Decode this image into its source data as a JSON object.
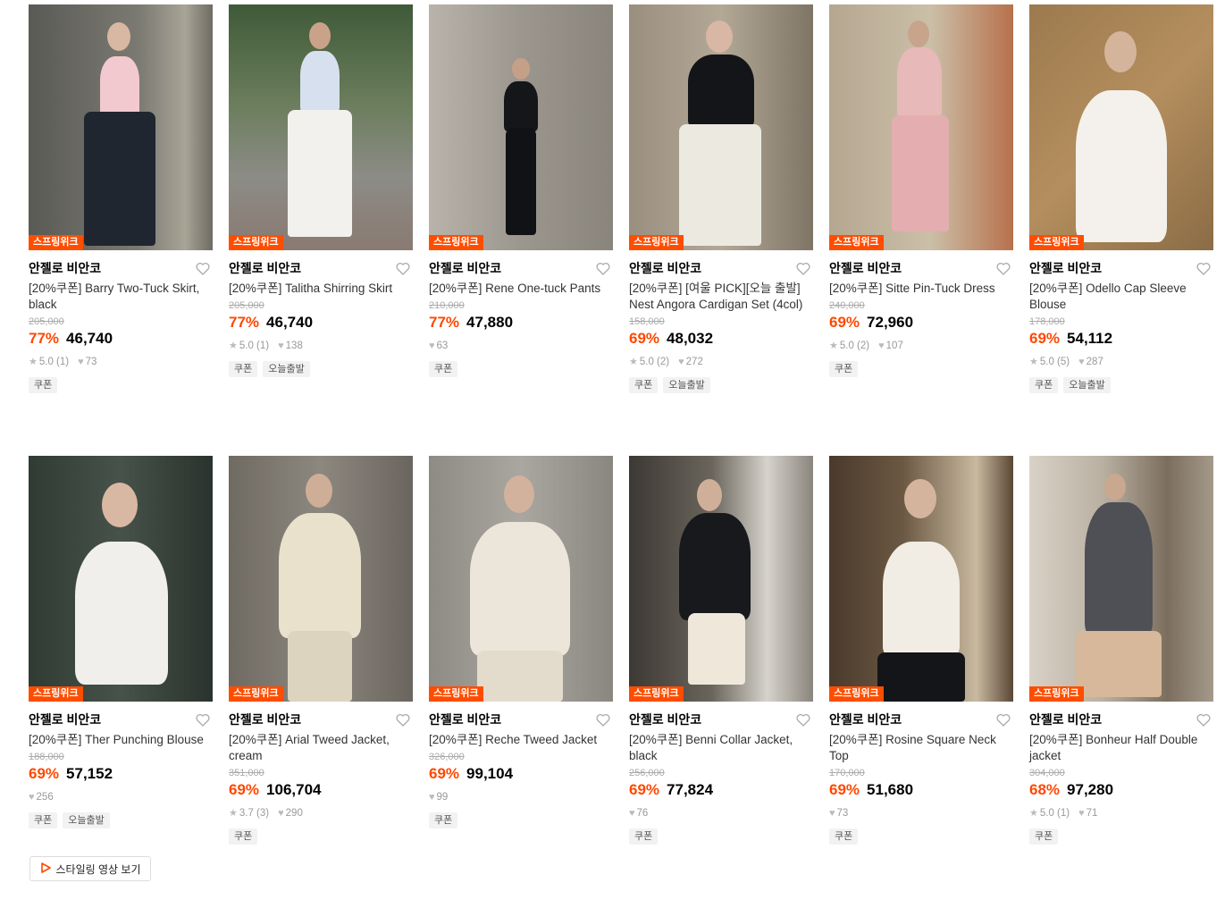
{
  "badge_label": "스프링위크",
  "brand": "안젤로 비안코",
  "video_button": "스타일링 영상 보기",
  "colors": {
    "accent": "#ff4800",
    "badge": "#ff4d00"
  },
  "products": [
    {
      "title": "[20%쿠폰] Barry Two-Tuck Skirt, black",
      "orig": "205,000",
      "disc": "77%",
      "price": "46,740",
      "rating": "5.0 (1)",
      "likes": "73",
      "tags": [
        "쿠폰"
      ]
    },
    {
      "title": "[20%쿠폰] Talitha Shirring Skirt",
      "orig": "205,000",
      "disc": "77%",
      "price": "46,740",
      "rating": "5.0 (1)",
      "likes": "138",
      "tags": [
        "쿠폰",
        "오늘출발"
      ]
    },
    {
      "title": "[20%쿠폰] Rene One-tuck Pants",
      "orig": "210,000",
      "disc": "77%",
      "price": "47,880",
      "rating": "",
      "likes": "63",
      "tags": [
        "쿠폰"
      ]
    },
    {
      "title": "[20%쿠폰] [여울 PICK][오늘 출발] Nest Angora Cardigan Set (4col)",
      "orig": "158,000",
      "disc": "69%",
      "price": "48,032",
      "rating": "5.0 (2)",
      "likes": "272",
      "tags": [
        "쿠폰",
        "오늘출발"
      ]
    },
    {
      "title": "[20%쿠폰] Sitte Pin-Tuck Dress",
      "orig": "240,000",
      "disc": "69%",
      "price": "72,960",
      "rating": "5.0 (2)",
      "likes": "107",
      "tags": [
        "쿠폰"
      ]
    },
    {
      "title": "[20%쿠폰] Odello Cap Sleeve Blouse",
      "orig": "178,000",
      "disc": "69%",
      "price": "54,112",
      "rating": "5.0 (5)",
      "likes": "287",
      "tags": [
        "쿠폰",
        "오늘출발"
      ]
    },
    {
      "title": "[20%쿠폰] Ther Punching Blouse",
      "orig": "188,000",
      "disc": "69%",
      "price": "57,152",
      "rating": "",
      "likes": "256",
      "tags": [
        "쿠폰",
        "오늘출발"
      ]
    },
    {
      "title": "[20%쿠폰] Arial Tweed Jacket, cream",
      "orig": "351,000",
      "disc": "69%",
      "price": "106,704",
      "rating": "3.7 (3)",
      "likes": "290",
      "tags": [
        "쿠폰"
      ]
    },
    {
      "title": "[20%쿠폰] Reche Tweed Jacket",
      "orig": "326,000",
      "disc": "69%",
      "price": "99,104",
      "rating": "",
      "likes": "99",
      "tags": [
        "쿠폰"
      ]
    },
    {
      "title": "[20%쿠폰] Benni Collar Jacket, black",
      "orig": "256,000",
      "disc": "69%",
      "price": "77,824",
      "rating": "",
      "likes": "76",
      "tags": [
        "쿠폰"
      ]
    },
    {
      "title": "[20%쿠폰] Rosine Square Neck Top",
      "orig": "170,000",
      "disc": "69%",
      "price": "51,680",
      "rating": "",
      "likes": "73",
      "tags": [
        "쿠폰"
      ]
    },
    {
      "title": "[20%쿠폰] Bonheur Half Double jacket",
      "orig": "304,000",
      "disc": "68%",
      "price": "97,280",
      "rating": "5.0 (1)",
      "likes": "71",
      "tags": [
        "쿠폰"
      ]
    }
  ]
}
